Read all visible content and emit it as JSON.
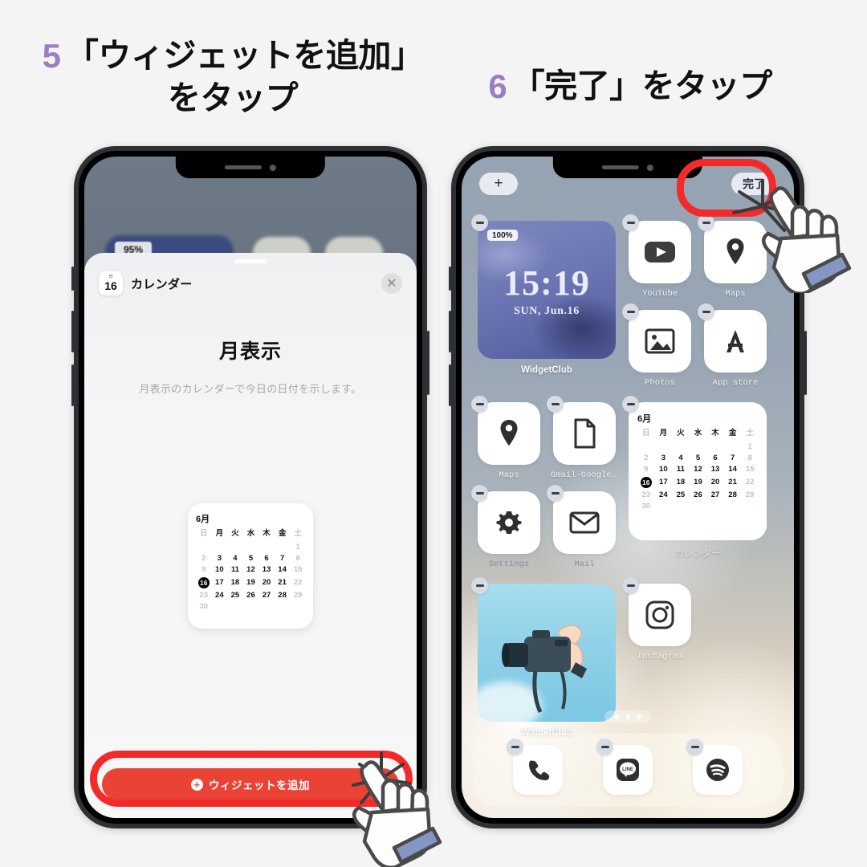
{
  "page": {
    "background_color": "#f4f4f5",
    "accent_purple": "#9b7fc0",
    "highlight_red": "#f42a2a",
    "button_red": "#ea4335"
  },
  "headings": [
    {
      "number": "5",
      "line1": "「ウィジェットを追加」",
      "line2": "をタップ"
    },
    {
      "number": "6",
      "line1": "「完了」をタップ",
      "line2": ""
    }
  ],
  "left_phone": {
    "background_widget_percent": "95%",
    "sheet": {
      "app_chip": {
        "top_label": "日",
        "day_number": "16"
      },
      "app_name": "カレンダー",
      "close_icon": "✕",
      "widget_title": "月表示",
      "widget_description": "月表示のカレンダーで今日の日付を示します。",
      "page_dots": {
        "count": 6,
        "active_index": 4
      }
    },
    "calendar_preview": {
      "month_label": "6月",
      "weekdays": [
        "日",
        "月",
        "火",
        "水",
        "木",
        "金",
        "土"
      ],
      "weekend_indices": [
        0,
        6
      ],
      "weeks": [
        [
          "",
          "",
          "",
          "",
          "",
          "",
          "1"
        ],
        [
          "2",
          "3",
          "4",
          "5",
          "6",
          "7",
          "8"
        ],
        [
          "9",
          "10",
          "11",
          "12",
          "13",
          "14",
          "15"
        ],
        [
          "16",
          "17",
          "18",
          "19",
          "20",
          "21",
          "22"
        ],
        [
          "23",
          "24",
          "25",
          "26",
          "27",
          "28",
          "29"
        ],
        [
          "30",
          "",
          "",
          "",
          "",
          "",
          ""
        ]
      ],
      "today": "16"
    },
    "add_button": {
      "icon": "＋",
      "label": "ウィジェットを追加"
    }
  },
  "right_phone": {
    "top_bar": {
      "add_label": "+",
      "done_label": "完了"
    },
    "clock_widget": {
      "time": "15:19",
      "date": "SUN, Jun.16",
      "battery_badge": "100%",
      "label": "WidgetClub"
    },
    "apps_row1": [
      {
        "label": "YouTube",
        "icon": "youtube-icon"
      },
      {
        "label": "Maps",
        "icon": "map-pin-icon"
      }
    ],
    "apps_row2": [
      {
        "label": "Photos",
        "icon": "photo-icon"
      },
      {
        "label": "App store",
        "icon": "app-store-icon"
      }
    ],
    "apps_row3": [
      {
        "label": "Maps",
        "icon": "map-pin-icon"
      },
      {
        "label": "Gmail-Google...",
        "icon": "document-icon"
      }
    ],
    "apps_row4": [
      {
        "label": "Settings",
        "icon": "gear-icon"
      },
      {
        "label": "Mail",
        "icon": "envelope-icon"
      }
    ],
    "calendar_widget": {
      "month_label": "6月",
      "weekdays": [
        "日",
        "月",
        "火",
        "水",
        "木",
        "金",
        "土"
      ],
      "weeks": [
        [
          "",
          "",
          "",
          "",
          "",
          "",
          "1"
        ],
        [
          "2",
          "3",
          "4",
          "5",
          "6",
          "7",
          "8"
        ],
        [
          "9",
          "10",
          "11",
          "12",
          "13",
          "14",
          "15"
        ],
        [
          "16",
          "17",
          "18",
          "19",
          "20",
          "21",
          "22"
        ],
        [
          "23",
          "24",
          "25",
          "26",
          "27",
          "28",
          "29"
        ],
        [
          "30",
          "",
          "",
          "",
          "",
          "",
          ""
        ]
      ],
      "today": "16",
      "label": "カレンダー"
    },
    "camera_widget": {
      "label": "WidgetClub"
    },
    "instagram_app": {
      "label": "Instagram",
      "icon": "instagram-icon"
    },
    "dock": [
      {
        "label": "Phone",
        "icon": "phone-icon"
      },
      {
        "label": "LINE",
        "icon": "line-icon"
      },
      {
        "label": "Spotify",
        "icon": "spotify-icon"
      }
    ],
    "page_dots": {
      "count": 3
    }
  }
}
